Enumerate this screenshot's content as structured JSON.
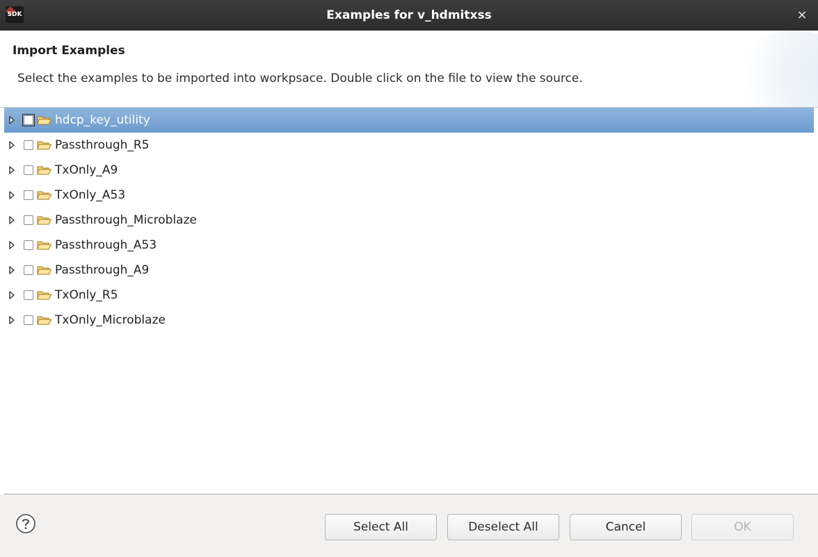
{
  "window": {
    "title": "Examples for v_hdmitxss",
    "icon_text": "SDK",
    "close_glyph": "×"
  },
  "header": {
    "title": "Import Examples",
    "description": "Select the examples to be imported into workpsace. Double click on the file to view the source."
  },
  "tree": {
    "items": [
      {
        "label": "hdcp_key_utility",
        "selected": true,
        "checked": false,
        "expanded": false
      },
      {
        "label": "Passthrough_R5",
        "selected": false,
        "checked": false,
        "expanded": false
      },
      {
        "label": "TxOnly_A9",
        "selected": false,
        "checked": false,
        "expanded": false
      },
      {
        "label": "TxOnly_A53",
        "selected": false,
        "checked": false,
        "expanded": false
      },
      {
        "label": "Passthrough_Microblaze",
        "selected": false,
        "checked": false,
        "expanded": false
      },
      {
        "label": "Passthrough_A53",
        "selected": false,
        "checked": false,
        "expanded": false
      },
      {
        "label": "Passthrough_A9",
        "selected": false,
        "checked": false,
        "expanded": false
      },
      {
        "label": "TxOnly_R5",
        "selected": false,
        "checked": false,
        "expanded": false
      },
      {
        "label": "TxOnly_Microblaze",
        "selected": false,
        "checked": false,
        "expanded": false
      }
    ]
  },
  "footer": {
    "help_icon": "question-mark-circle-icon",
    "buttons": {
      "select_all": "Select All",
      "deselect_all": "Deselect All",
      "cancel": "Cancel",
      "ok": "OK"
    },
    "ok_enabled": false
  },
  "colors": {
    "titlebar": "#2e2e2e",
    "selection": "#7aa5d4",
    "folder": "#e8b84a",
    "footer": "#f2f1f0"
  }
}
